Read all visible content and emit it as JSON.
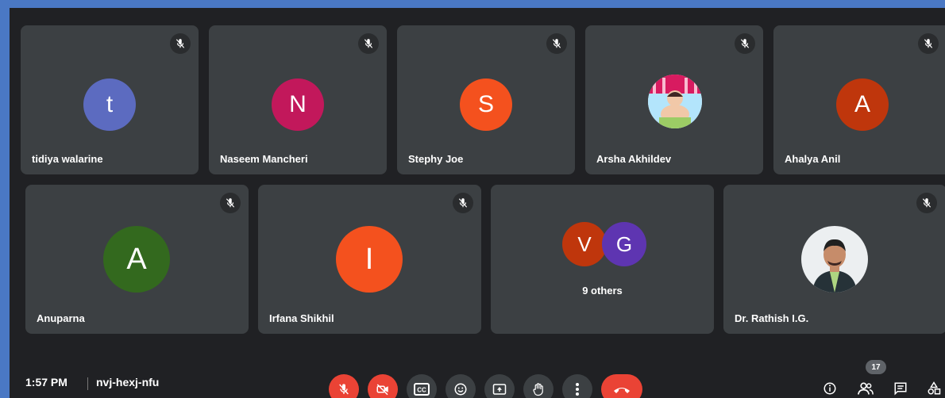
{
  "participants": [
    {
      "name": "tidiya walarine",
      "initial": "t",
      "color": "#5c6bc0",
      "muted": true
    },
    {
      "name": "Naseem Mancheri",
      "initial": "N",
      "color": "#c2185b",
      "muted": true
    },
    {
      "name": "Stephy Joe",
      "initial": "S",
      "color": "#f4511e",
      "muted": true
    },
    {
      "name": "Arsha Akhildev",
      "initial": "",
      "color": "#e8d9c8",
      "muted": true
    },
    {
      "name": "Ahalya Anil",
      "initial": "A",
      "color": "#bf360c",
      "muted": true
    },
    {
      "name": "Anuparna",
      "initial": "A",
      "color": "#33691e",
      "muted": true
    },
    {
      "name": "Irfana Shikhil",
      "initial": "I",
      "color": "#f4511e",
      "muted": true
    },
    {
      "name": "Dr. Rathish I.G.",
      "initial": "",
      "color": "#cfd8dc",
      "muted": true
    }
  ],
  "others": {
    "label": "9 others",
    "avatars": [
      {
        "initial": "V",
        "color": "#bf360c"
      },
      {
        "initial": "G",
        "color": "#5e35b1"
      }
    ]
  },
  "meeting": {
    "time": "1:57 PM",
    "code": "nvj-hexj-nfu",
    "participant_count": "17"
  },
  "controls": [
    {
      "icon": "mic-off-icon",
      "state": "off"
    },
    {
      "icon": "camera-off-icon",
      "state": "off"
    },
    {
      "icon": "captions-icon",
      "label": "CC"
    },
    {
      "icon": "emoji-icon"
    },
    {
      "icon": "present-screen-icon"
    },
    {
      "icon": "raise-hand-icon"
    },
    {
      "icon": "more-options-icon"
    },
    {
      "icon": "leave-call-icon"
    }
  ],
  "colors": {
    "background": "#202124",
    "tile": "#3c4043",
    "danger": "#ea4335"
  }
}
